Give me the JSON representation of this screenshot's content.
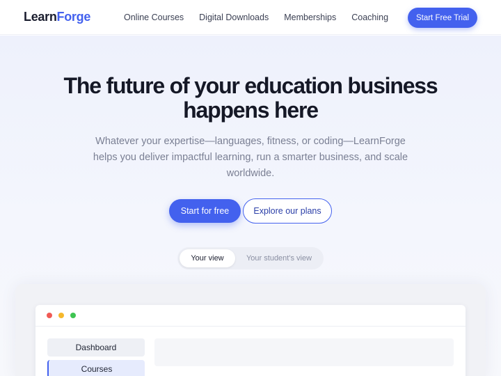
{
  "header": {
    "logo_part1": "Learn",
    "logo_part2": "Forge",
    "nav": [
      "Online Courses",
      "Digital Downloads",
      "Memberships",
      "Coaching"
    ],
    "cta": "Start Free Trial"
  },
  "hero": {
    "title_line1": "The future of your education business",
    "title_line2": "happens here",
    "subtitle": "Whatever your expertise—languages, fitness, or coding—LearnForge helps you deliver impactful learning, run a smarter business, and scale worldwide.",
    "primary_button": "Start for free",
    "secondary_button": "Explore our plans"
  },
  "view_toggle": {
    "active": "Your view",
    "inactive": "Your student's view"
  },
  "preview": {
    "sidebar_items": [
      "Dashboard",
      "Courses"
    ]
  },
  "colors": {
    "accent": "#4361ee",
    "heading": "#151826",
    "muted_text": "#7a7f93"
  }
}
